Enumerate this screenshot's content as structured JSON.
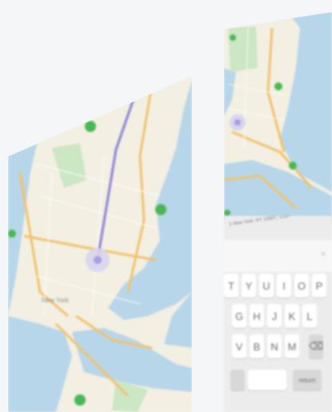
{
  "map": {
    "route_color": "#8f87d8",
    "water_color": "#b8d6e9",
    "land_color": "#f3efe2",
    "road_color": "#f2c26b",
    "park_color": "#cbe7c4",
    "marker_color": "#48b852",
    "labels": [
      "New York"
    ]
  },
  "search": {
    "address": "1 New York, NY 10007, USA"
  },
  "keyboard": {
    "rows": [
      [
        "T",
        "Y",
        "U",
        "I",
        "O",
        "P"
      ],
      [
        "G",
        "H",
        "J",
        "K",
        "L"
      ],
      [
        "V",
        "B",
        "N",
        "M",
        "⌫"
      ]
    ],
    "return_label": "return"
  }
}
